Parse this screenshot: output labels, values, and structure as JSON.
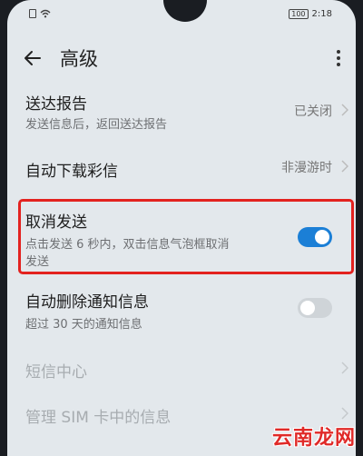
{
  "status_bar": {
    "time": "2:18",
    "battery": "100",
    "icons": [
      "sim-icon",
      "wifi-icon",
      "battery-icon"
    ]
  },
  "header": {
    "title": "高级",
    "back_icon": "back-arrow-icon",
    "more_icon": "more-vert-icon"
  },
  "settings": [
    {
      "label": "送达报告",
      "sub": "发送信息后，返回送达报告",
      "value": "已关闭"
    },
    {
      "label": "自动下载彩信",
      "value": "非漫游时"
    },
    {
      "label": "取消发送",
      "sub_line1": "点击发送 6 秒内，双击信息气泡框取消",
      "sub_line2": "发送",
      "toggle": "on"
    },
    {
      "label": "自动删除通知信息",
      "sub": "超过 30 天的通知信息",
      "toggle": "off"
    },
    {
      "label": "短信中心"
    },
    {
      "label": "管理 SIM 卡中的信息"
    }
  ],
  "watermark": "云南龙网",
  "colors": {
    "accent": "#1b7fd6",
    "highlight": "#e3221f",
    "background": "#e3e8ec"
  }
}
